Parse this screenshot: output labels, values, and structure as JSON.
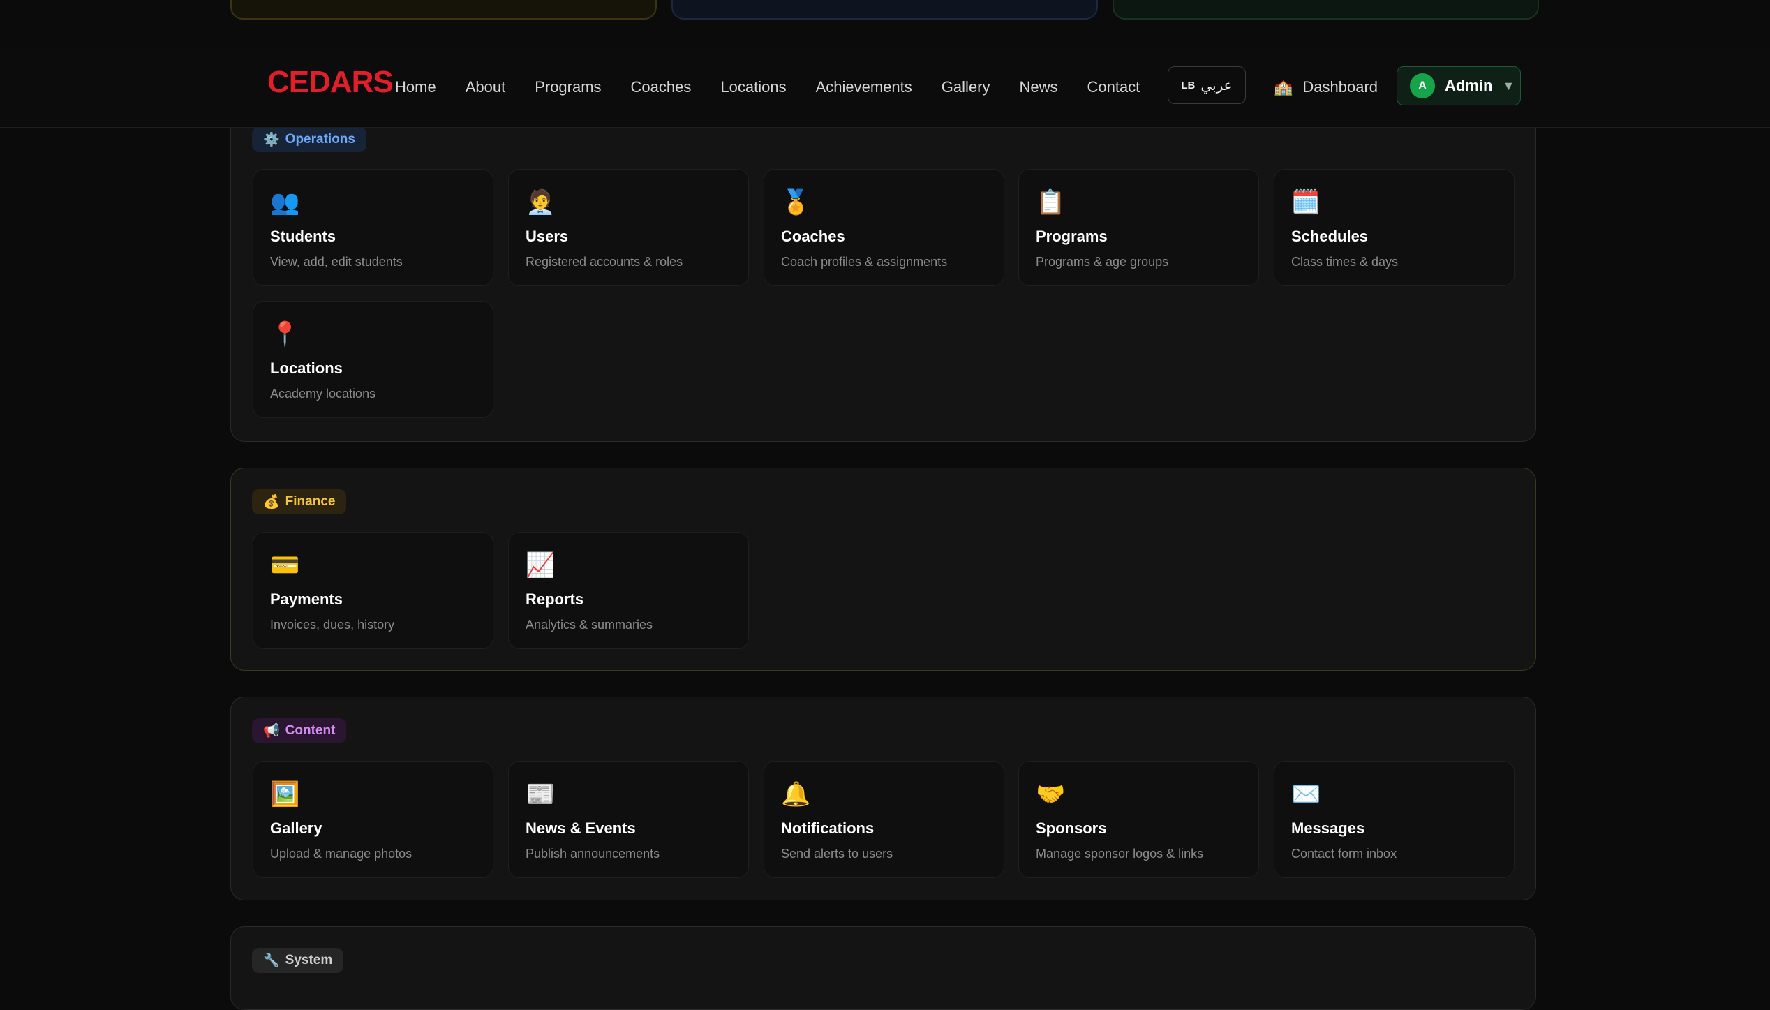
{
  "brand": {
    "logo_text": "CEDARS",
    "logo_color": "#e31e2b"
  },
  "nav": {
    "links": [
      "Home",
      "About",
      "Programs",
      "Coaches",
      "Locations",
      "Achievements",
      "Gallery",
      "News",
      "Contact"
    ],
    "lang_code": "LB",
    "lang_label": "عربي",
    "dashboard_icon": "🏫",
    "dashboard_label": "Dashboard",
    "admin_initial": "A",
    "admin_label": "Admin",
    "caret": "▼"
  },
  "sections": {
    "operations": {
      "icon": "⚙️",
      "label": "Operations",
      "tiles": [
        {
          "icon": "👥",
          "title": "Students",
          "subtitle": "View, add, edit students"
        },
        {
          "icon": "🧑‍💼",
          "title": "Users",
          "subtitle": "Registered accounts & roles"
        },
        {
          "icon": "🏅",
          "title": "Coaches",
          "subtitle": "Coach profiles & assignments"
        },
        {
          "icon": "📋",
          "title": "Programs",
          "subtitle": "Programs & age groups"
        },
        {
          "icon": "🗓️",
          "title": "Schedules",
          "subtitle": "Class times & days"
        },
        {
          "icon": "📍",
          "title": "Locations",
          "subtitle": "Academy locations"
        }
      ]
    },
    "finance": {
      "icon": "💰",
      "label": "Finance",
      "tiles": [
        {
          "icon": "💳",
          "title": "Payments",
          "subtitle": "Invoices, dues, history"
        },
        {
          "icon": "📈",
          "title": "Reports",
          "subtitle": "Analytics & summaries"
        }
      ]
    },
    "content": {
      "icon": "📢",
      "label": "Content",
      "tiles": [
        {
          "icon": "🖼️",
          "title": "Gallery",
          "subtitle": "Upload & manage photos"
        },
        {
          "icon": "📰",
          "title": "News & Events",
          "subtitle": "Publish announcements"
        },
        {
          "icon": "🔔",
          "title": "Notifications",
          "subtitle": "Send alerts to users"
        },
        {
          "icon": "🤝",
          "title": "Sponsors",
          "subtitle": "Manage sponsor logos & links"
        },
        {
          "icon": "✉️",
          "title": "Messages",
          "subtitle": "Contact form inbox"
        }
      ]
    },
    "system": {
      "icon": "🔧",
      "label": "System"
    }
  }
}
